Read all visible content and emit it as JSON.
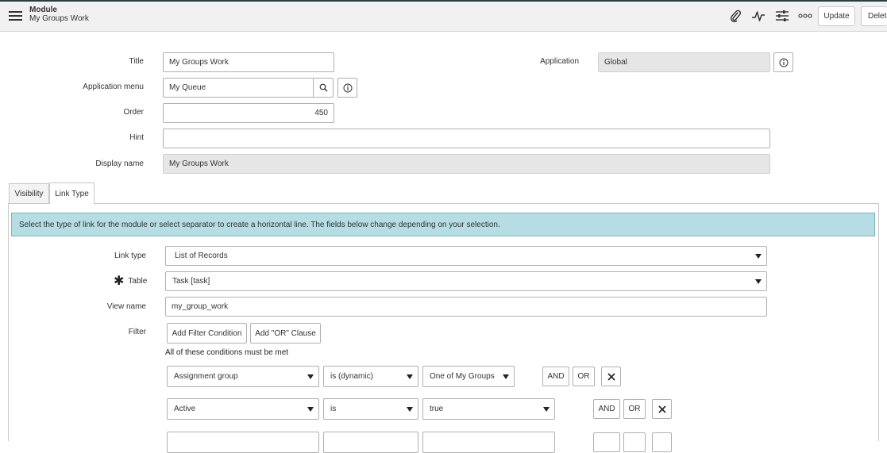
{
  "header": {
    "record_type": "Module",
    "record_name": "My Groups Work",
    "icons": [
      "paperclip-icon",
      "activity-icon",
      "sliders-icon",
      "more-icon"
    ],
    "update_label": "Update",
    "delete_label": "Delete"
  },
  "form": {
    "title_label": "Title",
    "title_value": "My Groups Work",
    "application_label": "Application",
    "application_value": "Global",
    "app_menu_label": "Application menu",
    "app_menu_value": "My Queue",
    "order_label": "Order",
    "order_value": "450",
    "hint_label": "Hint",
    "hint_value": "",
    "display_name_label": "Display name",
    "display_name_value": "My Groups Work"
  },
  "tabs": [
    {
      "label": "Visibility",
      "active": false
    },
    {
      "label": "Link Type",
      "active": true
    }
  ],
  "link_section": {
    "info_text": "Select the type of link for the module or select separator to create a horizontal line. The fields below change depending on your selection.",
    "link_type_label": "Link type",
    "link_type_value": "List of Records",
    "table_label": "Table",
    "table_value": "Task [task]",
    "view_name_label": "View name",
    "view_name_value": "my_group_work",
    "filter_label": "Filter",
    "add_filter_label": "Add Filter Condition",
    "add_or_label": "Add \"OR\" Clause",
    "conditions_title": "All of these conditions must be met",
    "conditions": [
      {
        "field": "Assignment group",
        "operator": "is (dynamic)",
        "value": "One of My Groups",
        "and_label": "AND",
        "or_label": "OR"
      },
      {
        "field": "Active",
        "operator": "is",
        "value": "true",
        "and_label": "AND",
        "or_label": "OR"
      }
    ]
  },
  "colors": {
    "header_bg": "#f1f1f1",
    "info_bg": "#b6dde3",
    "readonly_bg": "#e6e6e6"
  }
}
